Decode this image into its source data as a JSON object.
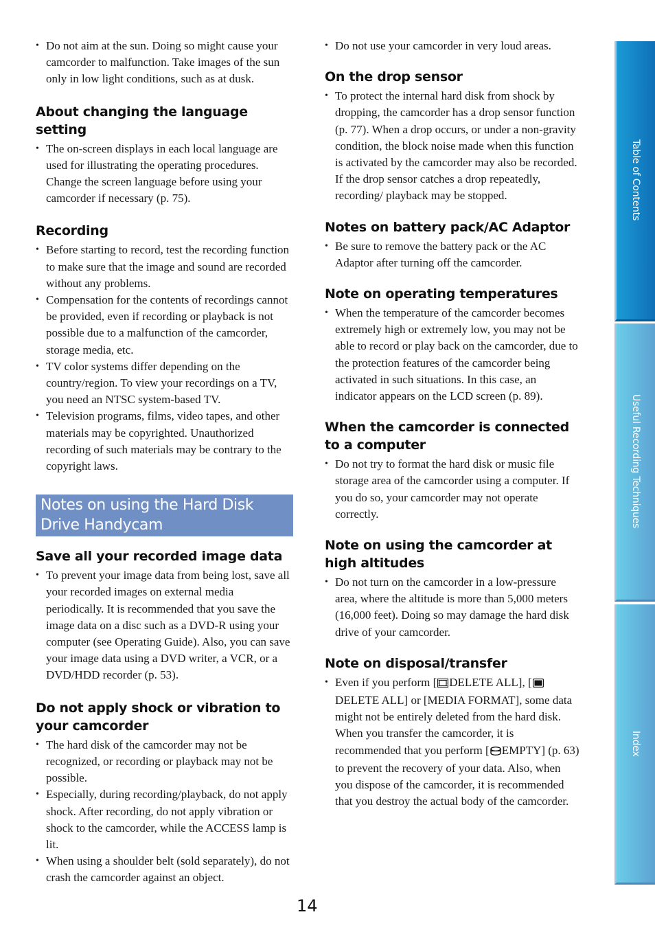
{
  "page_number": "14",
  "side_tabs": [
    {
      "label": "Table of Contents",
      "active": true
    },
    {
      "label": "Useful Recording Techniques",
      "active": false
    },
    {
      "label": "Index",
      "active": false
    }
  ],
  "left_column": {
    "intro_bullets": [
      "Do not aim at the sun. Doing so might cause your camcorder to malfunction. Take images of the sun only in low light conditions, such as at dusk."
    ],
    "language": {
      "heading": "About changing the language setting",
      "bullets": [
        "The on-screen displays in each local language are used for illustrating the operating procedures. Change the screen language before using your camcorder if necessary (p. 75)."
      ]
    },
    "recording": {
      "heading": "Recording",
      "bullets": [
        "Before starting to record, test the recording function to make sure that the image and sound are recorded without any problems.",
        "Compensation for the contents of recordings cannot be provided, even if recording or playback is not possible due to a malfunction of the camcorder, storage media, etc.",
        "TV color systems differ depending on the country/region. To view your recordings on a TV, you need an NTSC system-based TV.",
        "Television programs, films, video tapes, and other materials may be copyrighted. Unauthorized recording of such materials may be contrary to the copyright laws."
      ]
    },
    "banner": "Notes on using the Hard Disk Drive Handycam",
    "save_data": {
      "heading": "Save all your recorded image data",
      "bullets": [
        "To prevent your image data from being lost, save all your recorded images on external media periodically. It is recommended that you save the image data on a disc such as a DVD-R using your computer (see Operating Guide). Also, you can save your image data using a DVD writer, a VCR, or a DVD/HDD recorder (p. 53)."
      ]
    },
    "shock": {
      "heading": "Do not apply shock or vibration to your camcorder",
      "bullets": [
        "The hard disk of the camcorder may not be recognized, or recording or playback may not be possible.",
        "Especially, during recording/playback, do not apply shock. After recording, do not apply vibration or shock to the camcorder, while the ACCESS lamp is lit.",
        "When using a shoulder belt (sold separately), do not crash the camcorder against an object."
      ]
    }
  },
  "right_column": {
    "intro_bullets": [
      "Do not use your camcorder in very loud areas."
    ],
    "drop_sensor": {
      "heading": "On the drop sensor",
      "bullets": [
        "To protect the internal hard disk from shock by dropping, the camcorder has a drop sensor function (p. 77). When a drop occurs, or under a non-gravity condition, the block noise made when this function is activated by the camcorder may also be recorded. If the drop sensor catches a drop repeatedly, recording/ playback may be stopped."
      ]
    },
    "battery": {
      "heading": "Notes on battery pack/AC Adaptor",
      "bullets": [
        "Be sure to remove the battery pack or the AC Adaptor after turning off the camcorder."
      ]
    },
    "temperatures": {
      "heading": "Note on operating temperatures",
      "bullets": [
        "When the temperature of the camcorder becomes extremely high or extremely low, you may not be able to record or play back on the camcorder, due to the protection features of the camcorder being activated in such situations. In this case, an indicator appears on the LCD screen (p. 89)."
      ]
    },
    "computer": {
      "heading": "When the camcorder is connected to a computer",
      "bullets": [
        "Do not try to format the hard disk or music file storage area of the camcorder using a computer. If you do so, your camcorder may not operate correctly."
      ]
    },
    "altitudes": {
      "heading": "Note on using the camcorder at high altitudes",
      "bullets": [
        "Do not turn on the camcorder in a low-pressure area, where the altitude is more than 5,000 meters (16,000 feet). Doing so may damage the hard disk drive of your camcorder."
      ]
    },
    "disposal": {
      "heading": "Note on disposal/transfer",
      "bullet_parts": {
        "p1": "Even if you perform [",
        "p2": "DELETE ALL], [",
        "p3": "DELETE ALL] or [MEDIA FORMAT], some data might not be entirely deleted from the hard disk. When you transfer the camcorder, it is recommended that you perform [",
        "p4": "EMPTY] (p. 63) to prevent the recovery of your data. Also, when you dispose of the camcorder, it is recommended that you destroy the actual body of the camcorder."
      },
      "icons": [
        "movie-film-icon",
        "photo-icon",
        "hard-disk-icon"
      ]
    }
  }
}
